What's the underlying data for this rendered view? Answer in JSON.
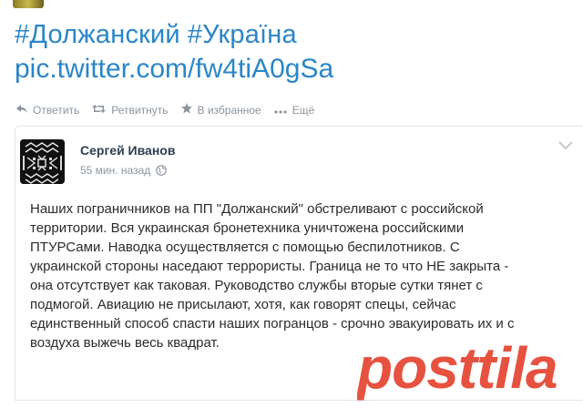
{
  "tweet": {
    "hashtags": [
      "#Должанский",
      "#Україна"
    ],
    "pic_link": "pic.twitter.com/fw4tiA0gSa",
    "actions": [
      {
        "icon": "reply-icon",
        "label": "Ответить"
      },
      {
        "icon": "retweet-icon",
        "label": "Ретвитнуть"
      },
      {
        "icon": "star-icon",
        "label": "В избранное"
      },
      {
        "icon": "more-icon",
        "label": "Ещё"
      }
    ]
  },
  "post": {
    "author": "Сергей Иванов",
    "time": "55 мин. назад",
    "lines": [
      "Наших пограничников на ПП \"Должанский\" обстреливают с российской",
      "территории. Вся украинская бронетехника уничтожена российскими",
      "ПТУРСами. Наводка осуществляется с помощью беспилотников. С",
      "украинской стороны наседают террористы. Граница не то что НЕ закрыта -",
      "она отсутствует как таковая. Руководство службы вторые сутки тянет с",
      "подмогой. Авиацию не присылают, хотя, как говорят спецы, сейчас",
      "единственный способ спасти наших погранцов - срочно эвакуировать их и с",
      "воздуха выжечь весь квадрат."
    ]
  },
  "watermark": {
    "text": "posttila.ru",
    "color": "#e23a24"
  },
  "colors": {
    "link": "#2a86c8",
    "meta": "#8c959e",
    "author": "#2c3e50"
  }
}
